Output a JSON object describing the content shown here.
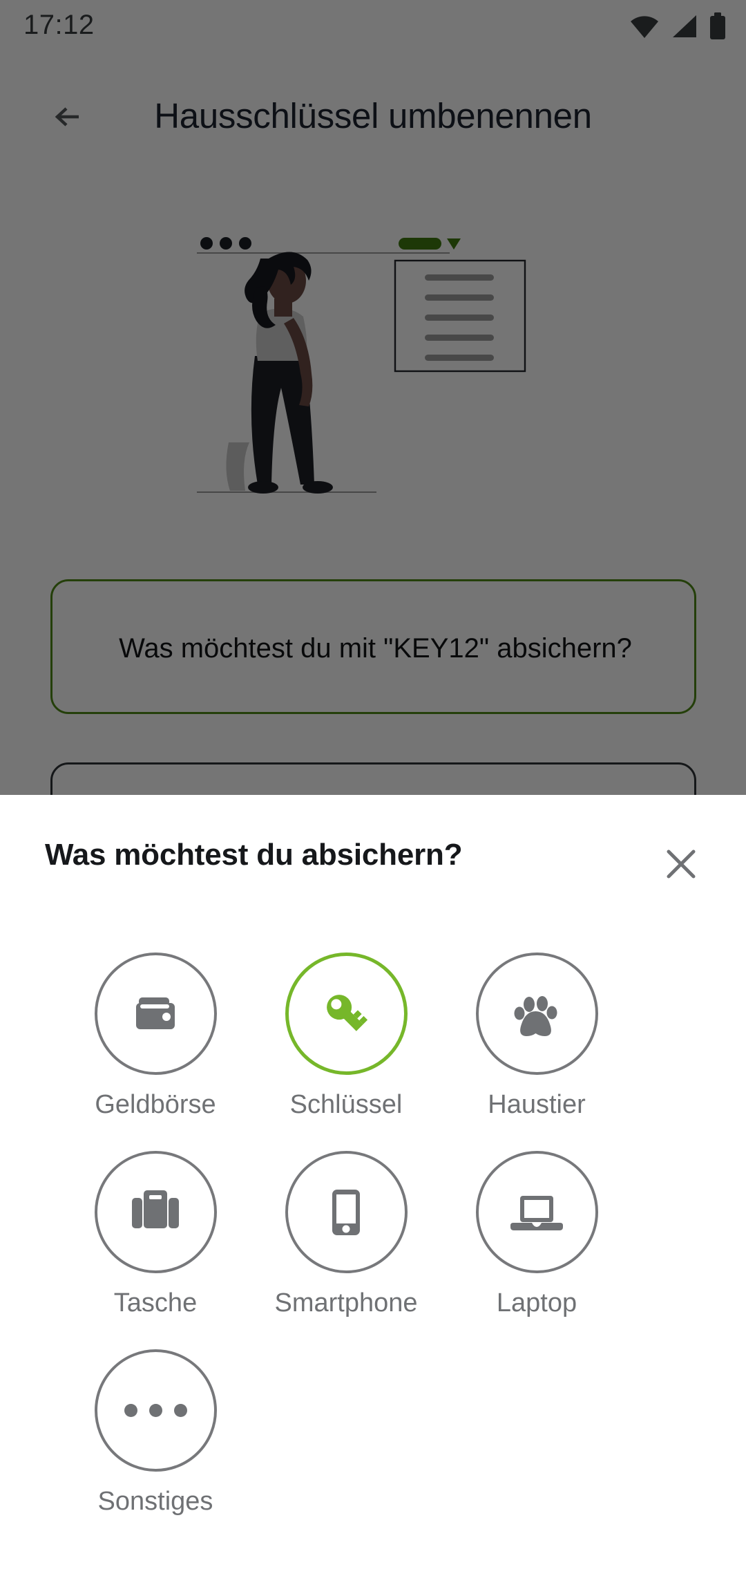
{
  "status_bar": {
    "time": "17:12",
    "icons": [
      "wifi-icon",
      "cellular-signal-icon",
      "battery-icon"
    ]
  },
  "app_bar": {
    "back_icon": "arrow-left-icon",
    "title": "Hausschlüssel umbenennen"
  },
  "background_screen": {
    "illustration": "person-walking-with-document-illustration",
    "fields": [
      {
        "value": "Was möchtest du mit \"KEY12\" absichern?",
        "accent": "#4f8a16"
      },
      {
        "value": "",
        "accent": "#2f3337"
      }
    ]
  },
  "sheet": {
    "title": "Was möchtest du absichern?",
    "close_icon": "close-icon",
    "selected_option": "Schlüssel",
    "accent_color": "#76b72a",
    "inactive_color": "#77787b",
    "label_color": "#6f7174",
    "options": [
      {
        "label": "Geldbörse",
        "icon": "wallet-icon",
        "selected": false
      },
      {
        "label": "Schlüssel",
        "icon": "key-icon",
        "selected": true
      },
      {
        "label": "Haustier",
        "icon": "paw-icon",
        "selected": false
      },
      {
        "label": "Tasche",
        "icon": "briefcase-icon",
        "selected": false
      },
      {
        "label": "Smartphone",
        "icon": "smartphone-icon",
        "selected": false
      },
      {
        "label": "Laptop",
        "icon": "laptop-icon",
        "selected": false
      },
      {
        "label": "Sonstiges",
        "icon": "more-dots-icon",
        "selected": false
      }
    ]
  }
}
